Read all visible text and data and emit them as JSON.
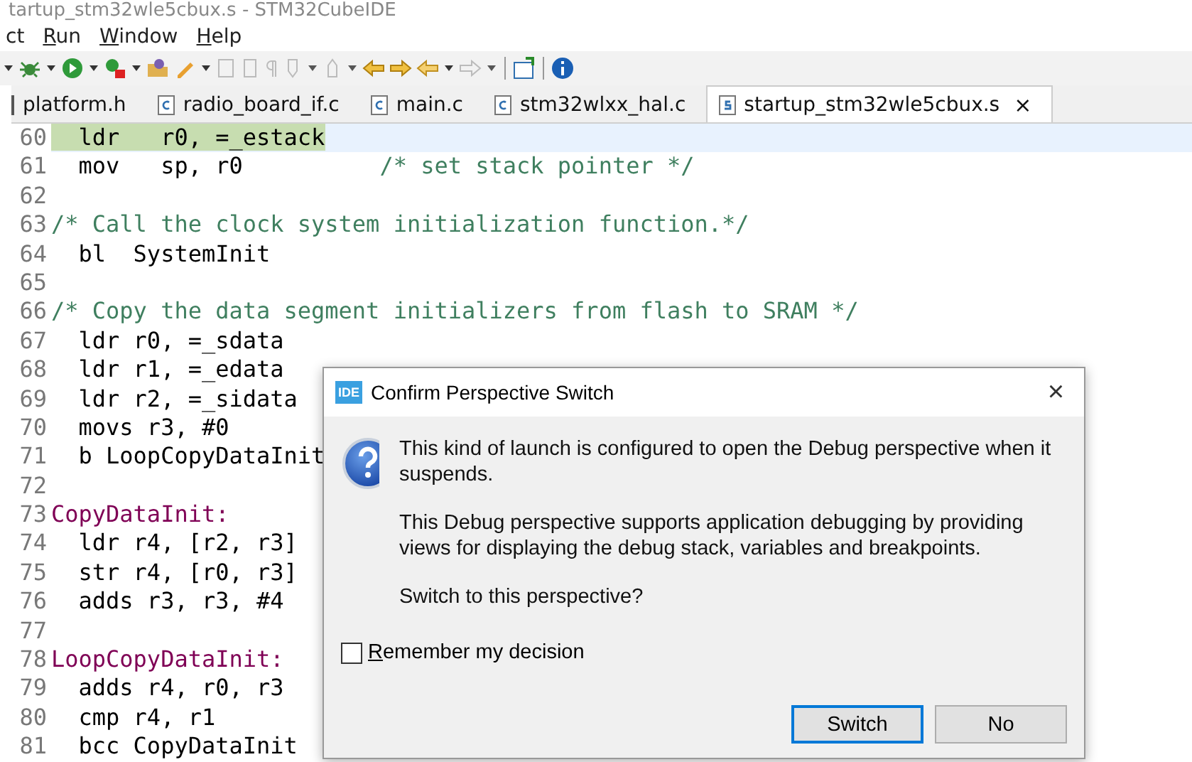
{
  "window": {
    "title": "tartup_stm32wle5cbux.s - STM32CubeIDE"
  },
  "menu": [
    {
      "label": "ct",
      "underline_first": false
    },
    {
      "label": "Run",
      "underline_first": true
    },
    {
      "label": "Window",
      "underline_first": true
    },
    {
      "label": "Help",
      "underline_first": true
    }
  ],
  "tabs": [
    {
      "label": "platform.h",
      "kind": "header",
      "selected": false
    },
    {
      "label": "radio_board_if.c",
      "kind": "csource",
      "selected": false
    },
    {
      "label": "main.c",
      "kind": "csource",
      "selected": false
    },
    {
      "label": "stm32wlxx_hal.c",
      "kind": "csource",
      "selected": false
    },
    {
      "label": "startup_stm32wle5cbux.s",
      "kind": "assembly",
      "selected": true,
      "close": "×"
    }
  ],
  "editor": {
    "lines": [
      {
        "number": "60",
        "current": true,
        "parts": [
          {
            "text": "  ldr   r0, =_estack",
            "kind": "mark"
          }
        ]
      },
      {
        "number": "61",
        "current": false,
        "parts": [
          {
            "text": "  mov   sp, r0          ",
            "kind": "code"
          },
          {
            "text": "/* set stack pointer */",
            "kind": "comment"
          }
        ]
      },
      {
        "number": "62",
        "current": false
      },
      {
        "number": "63",
        "current": false,
        "parts": [
          {
            "text": "/* Call the clock system initialization function.*/",
            "kind": "comment"
          }
        ]
      },
      {
        "number": "64",
        "current": false,
        "parts": [
          {
            "text": "  bl  SystemInit",
            "kind": "code"
          }
        ]
      },
      {
        "number": "65",
        "current": false
      },
      {
        "number": "66",
        "current": false,
        "parts": [
          {
            "text": "/* Copy the data segment initializers from flash to SRAM */",
            "kind": "comment"
          }
        ]
      },
      {
        "number": "67",
        "current": false,
        "parts": [
          {
            "text": "  ldr r0, =_sdata",
            "kind": "code"
          }
        ]
      },
      {
        "number": "68",
        "current": false,
        "parts": [
          {
            "text": "  ldr r1, =_edata",
            "kind": "code"
          }
        ]
      },
      {
        "number": "69",
        "current": false,
        "parts": [
          {
            "text": "  ldr r2, =_sidata",
            "kind": "code"
          }
        ]
      },
      {
        "number": "70",
        "current": false,
        "parts": [
          {
            "text": "  movs r3, #0",
            "kind": "code"
          }
        ]
      },
      {
        "number": "71",
        "current": false,
        "parts": [
          {
            "text": "  b LoopCopyDataInit",
            "kind": "code"
          }
        ]
      },
      {
        "number": "72",
        "current": false
      },
      {
        "number": "73",
        "current": false,
        "parts": [
          {
            "text": "CopyDataInit:",
            "kind": "label"
          }
        ]
      },
      {
        "number": "74",
        "current": false,
        "parts": [
          {
            "text": "  ldr r4, [r2, r3]",
            "kind": "code"
          }
        ]
      },
      {
        "number": "75",
        "current": false,
        "parts": [
          {
            "text": "  str r4, [r0, r3]",
            "kind": "code"
          }
        ]
      },
      {
        "number": "76",
        "current": false,
        "parts": [
          {
            "text": "  adds r3, r3, #4",
            "kind": "code"
          }
        ]
      },
      {
        "number": "77",
        "current": false
      },
      {
        "number": "78",
        "current": false,
        "parts": [
          {
            "text": "LoopCopyDataInit:",
            "kind": "label"
          }
        ]
      },
      {
        "number": "79",
        "current": false,
        "parts": [
          {
            "text": "  adds r4, r0, r3",
            "kind": "code"
          }
        ]
      },
      {
        "number": "80",
        "current": false,
        "parts": [
          {
            "text": "  cmp r4, r1",
            "kind": "code"
          }
        ]
      },
      {
        "number": "81",
        "current": false,
        "parts": [
          {
            "text": "  bcc CopyDataInit",
            "kind": "code"
          }
        ]
      }
    ]
  },
  "dialog": {
    "badge": "IDE",
    "title": "Confirm Perspective Switch",
    "close": "×",
    "paragraphs": [
      "This kind of launch is configured to open the Debug perspective when it suspends.",
      "This Debug perspective supports application debugging by providing views for displaying the debug stack, variables and breakpoints.",
      "Switch to this perspective?"
    ],
    "checkbox": {
      "label": "Remember my decision",
      "checked": false
    },
    "buttons": [
      {
        "label": "Switch",
        "default": true
      },
      {
        "label": "No",
        "default": false
      }
    ]
  }
}
